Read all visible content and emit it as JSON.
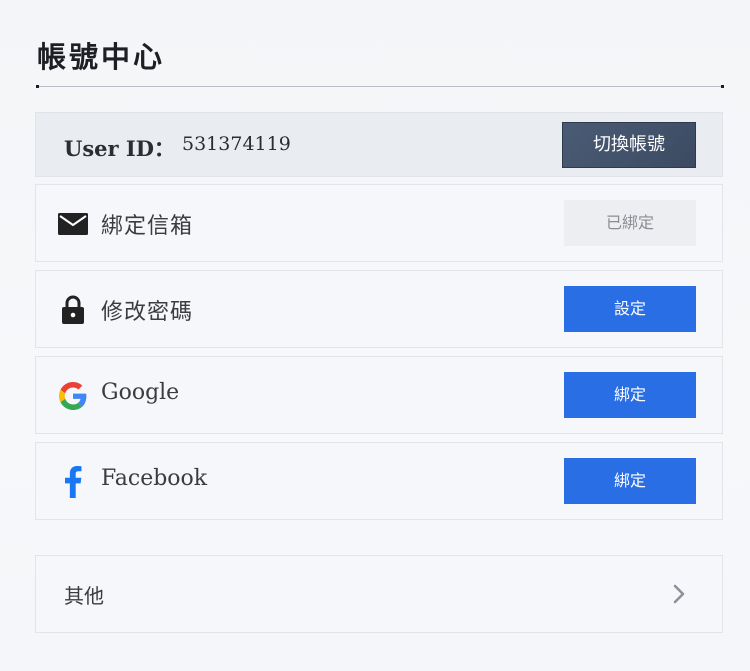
{
  "page": {
    "title": "帳號中心"
  },
  "user": {
    "id_label": "User ID：",
    "id_value": "531374119",
    "switch_label": "切換帳號"
  },
  "bindings": {
    "email": {
      "icon": "mail-icon",
      "label": "綁定信箱",
      "action": "已綁定",
      "state": "bound"
    },
    "password": {
      "icon": "lock-icon",
      "label": "修改密碼",
      "action": "設定"
    },
    "google": {
      "icon": "google-icon",
      "label": "Google",
      "action": "綁定"
    },
    "facebook": {
      "icon": "facebook-icon",
      "label": "Facebook",
      "action": "綁定"
    }
  },
  "other": {
    "label": "其他",
    "icon": "chevron-right-icon"
  },
  "colors": {
    "primary": "#2a6ee6",
    "switch": "#44546d",
    "facebook": "#1877f2"
  }
}
